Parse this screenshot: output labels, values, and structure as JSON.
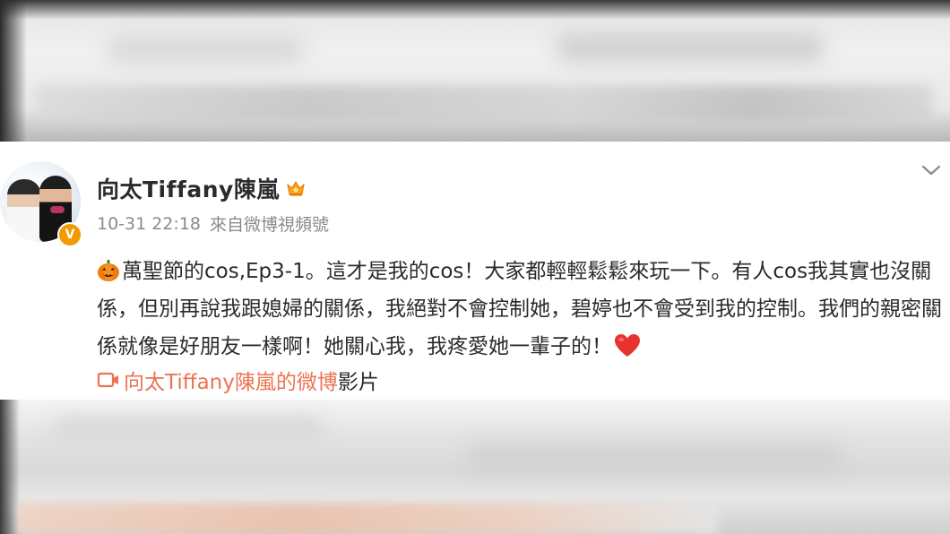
{
  "post": {
    "username": "向太Tiffany陳嵐",
    "timestamp": "10-31 22:18",
    "source": "來自微博視頻號",
    "body": "萬聖節的cos,Ep3-1。這才是我的cos！大家都輕輕鬆鬆來玩一下。有人cos我其實也沒關係，但別再說我跟媳婦的關係，我絕對不會控制她，碧婷也不會受到我的控制。我們的親密關係就像是好朋友一樣啊！她關心我，我疼愛她一輩子的！",
    "video_owner": "向太Tiffany陳嵐的微博",
    "video_suffix": "影片",
    "verify_badge": "V"
  },
  "icons": {
    "vip": "crown-icon",
    "menu": "chevron-down-icon",
    "emoji_start": "pumpkin-emoji-icon",
    "emoji_end": "red-heart-emoji-icon",
    "video": "video-camera-icon"
  },
  "colors": {
    "accent": "#eb7350",
    "verify_badge": "#f29a00",
    "text": "#2b2b2b",
    "meta": "#8b8b8b"
  }
}
